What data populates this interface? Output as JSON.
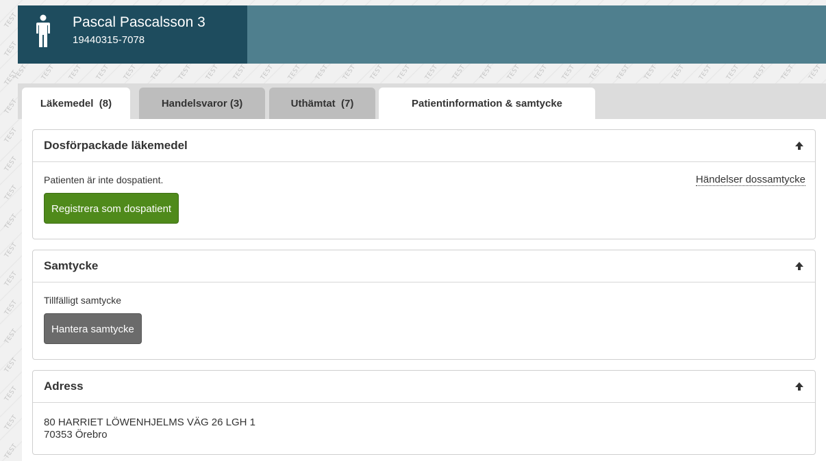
{
  "patient": {
    "name": "Pascal Pascalsson 3",
    "personal_number": "19440315-7078"
  },
  "watermark_text": "TEST",
  "tabs": [
    {
      "label": "Läkemedel  (8)",
      "active": false
    },
    {
      "label": "Handelsvaror (3)",
      "active": false
    },
    {
      "label": "Uthämtat  (7)",
      "active": false
    },
    {
      "label": "Patientinformation & samtycke",
      "active": true
    }
  ],
  "panels": {
    "dos": {
      "title": "Dosförpackade läkemedel",
      "status_text": "Patienten är inte dospatient.",
      "link_label": "Händelser dossamtycke",
      "button_label": "Registrera som dospatient"
    },
    "samtycke": {
      "title": "Samtycke",
      "status_text": "Tillfälligt samtycke",
      "button_label": "Hantera samtycke"
    },
    "adress": {
      "title": "Adress",
      "street": "80 HARRIET LÖWENHJELMS VÄG 26 LGH 1",
      "postal": "70353 Örebro"
    }
  },
  "colors": {
    "header_bar": "#4f7f8e",
    "patient_box": "#1e4c5e",
    "green_button": "#4f8a1b",
    "grey_button": "#6b6b6b"
  },
  "icons": {
    "person": "person-icon",
    "collapse": "arrow-up-icon"
  }
}
